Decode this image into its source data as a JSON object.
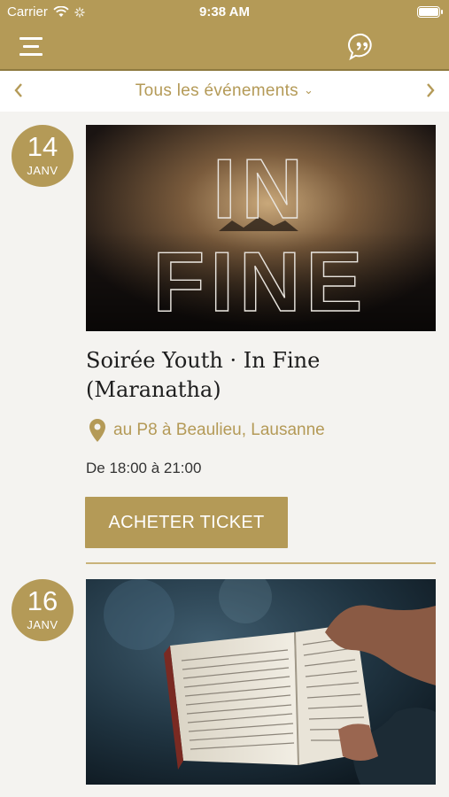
{
  "status_bar": {
    "carrier": "Carrier",
    "time": "9:38 AM"
  },
  "header": {
    "menu_icon": "menu-icon",
    "chat_icon": "quote-bubble-icon"
  },
  "subnav": {
    "title": "Tous les événements",
    "dropdown_icon": "chevron-down-icon",
    "prev_icon": "chevron-left-icon",
    "next_icon": "chevron-right-icon"
  },
  "events": [
    {
      "day": "14",
      "month": "JANV",
      "title": "Soirée Youth · In Fine (Maranatha)",
      "image_text_line1": "IN",
      "image_text_line2": "FINE",
      "location": "au P8 à Beaulieu, Lausanne",
      "time": "De 18:00 à 21:00",
      "button": "ACHETER TICKET"
    },
    {
      "day": "16",
      "month": "JANV"
    }
  ],
  "colors": {
    "accent": "#b49a57",
    "background": "#f4f3f0"
  }
}
